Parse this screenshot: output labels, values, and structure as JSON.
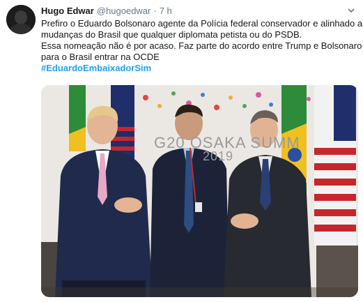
{
  "tweet": {
    "author_name": "Hugo Edwar",
    "author_handle": "@hugoedwar",
    "separator": "·",
    "time": "7 h",
    "lines": [
      "Prefiro o Eduardo Bolsonaro agente da Polícia federal conservador e alinhado as",
      "mudanças do Brasil que qualquer diplomata petista ou do PSDB.",
      "Essa nomeação não é por acaso. Faz parte do acordo entre Trump e Bolsonaro",
      "para o Brasil entrar na OCDE"
    ],
    "hashtag": "#EduardoEmbaixadorSim"
  },
  "media": {
    "backdrop_line1": "G20 OSAKA SUMM",
    "backdrop_line2": "2019"
  },
  "icons": {
    "avatar": "avatar-image",
    "menu": "chevron-down-icon"
  },
  "colors": {
    "link": "#1da1f2",
    "text": "#14171a",
    "muted": "#657786"
  }
}
